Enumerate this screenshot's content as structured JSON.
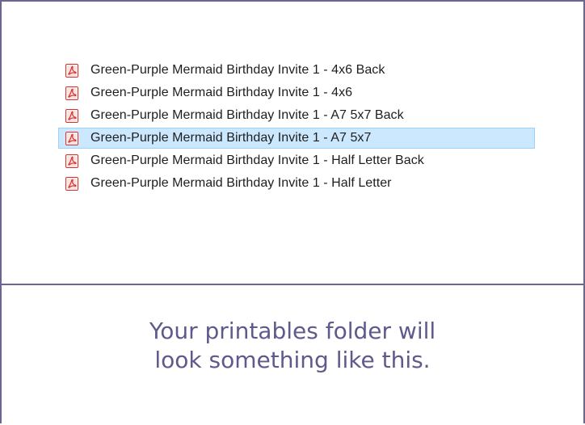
{
  "files": [
    {
      "name": "Green-Purple Mermaid Birthday Invite 1 - 4x6 Back",
      "icon": "pdf-icon",
      "selected": false
    },
    {
      "name": "Green-Purple Mermaid Birthday Invite 1 - 4x6",
      "icon": "pdf-icon",
      "selected": false
    },
    {
      "name": "Green-Purple Mermaid Birthday Invite 1 - A7 5x7 Back",
      "icon": "pdf-icon",
      "selected": false
    },
    {
      "name": "Green-Purple Mermaid Birthday Invite 1 - A7 5x7",
      "icon": "pdf-icon",
      "selected": true
    },
    {
      "name": "Green-Purple Mermaid Birthday Invite 1 - Half Letter Back",
      "icon": "pdf-icon",
      "selected": false
    },
    {
      "name": "Green-Purple Mermaid Birthday Invite 1 - Half Letter",
      "icon": "pdf-icon",
      "selected": false
    }
  ],
  "caption": {
    "line1": "Your printables folder will",
    "line2": "look something like this."
  },
  "colors": {
    "border": "#6a6592",
    "caption_text": "#5f5a8c",
    "selection_bg": "#cce8ff",
    "selection_border": "#99d1ff",
    "pdf_red": "#d9302c"
  }
}
